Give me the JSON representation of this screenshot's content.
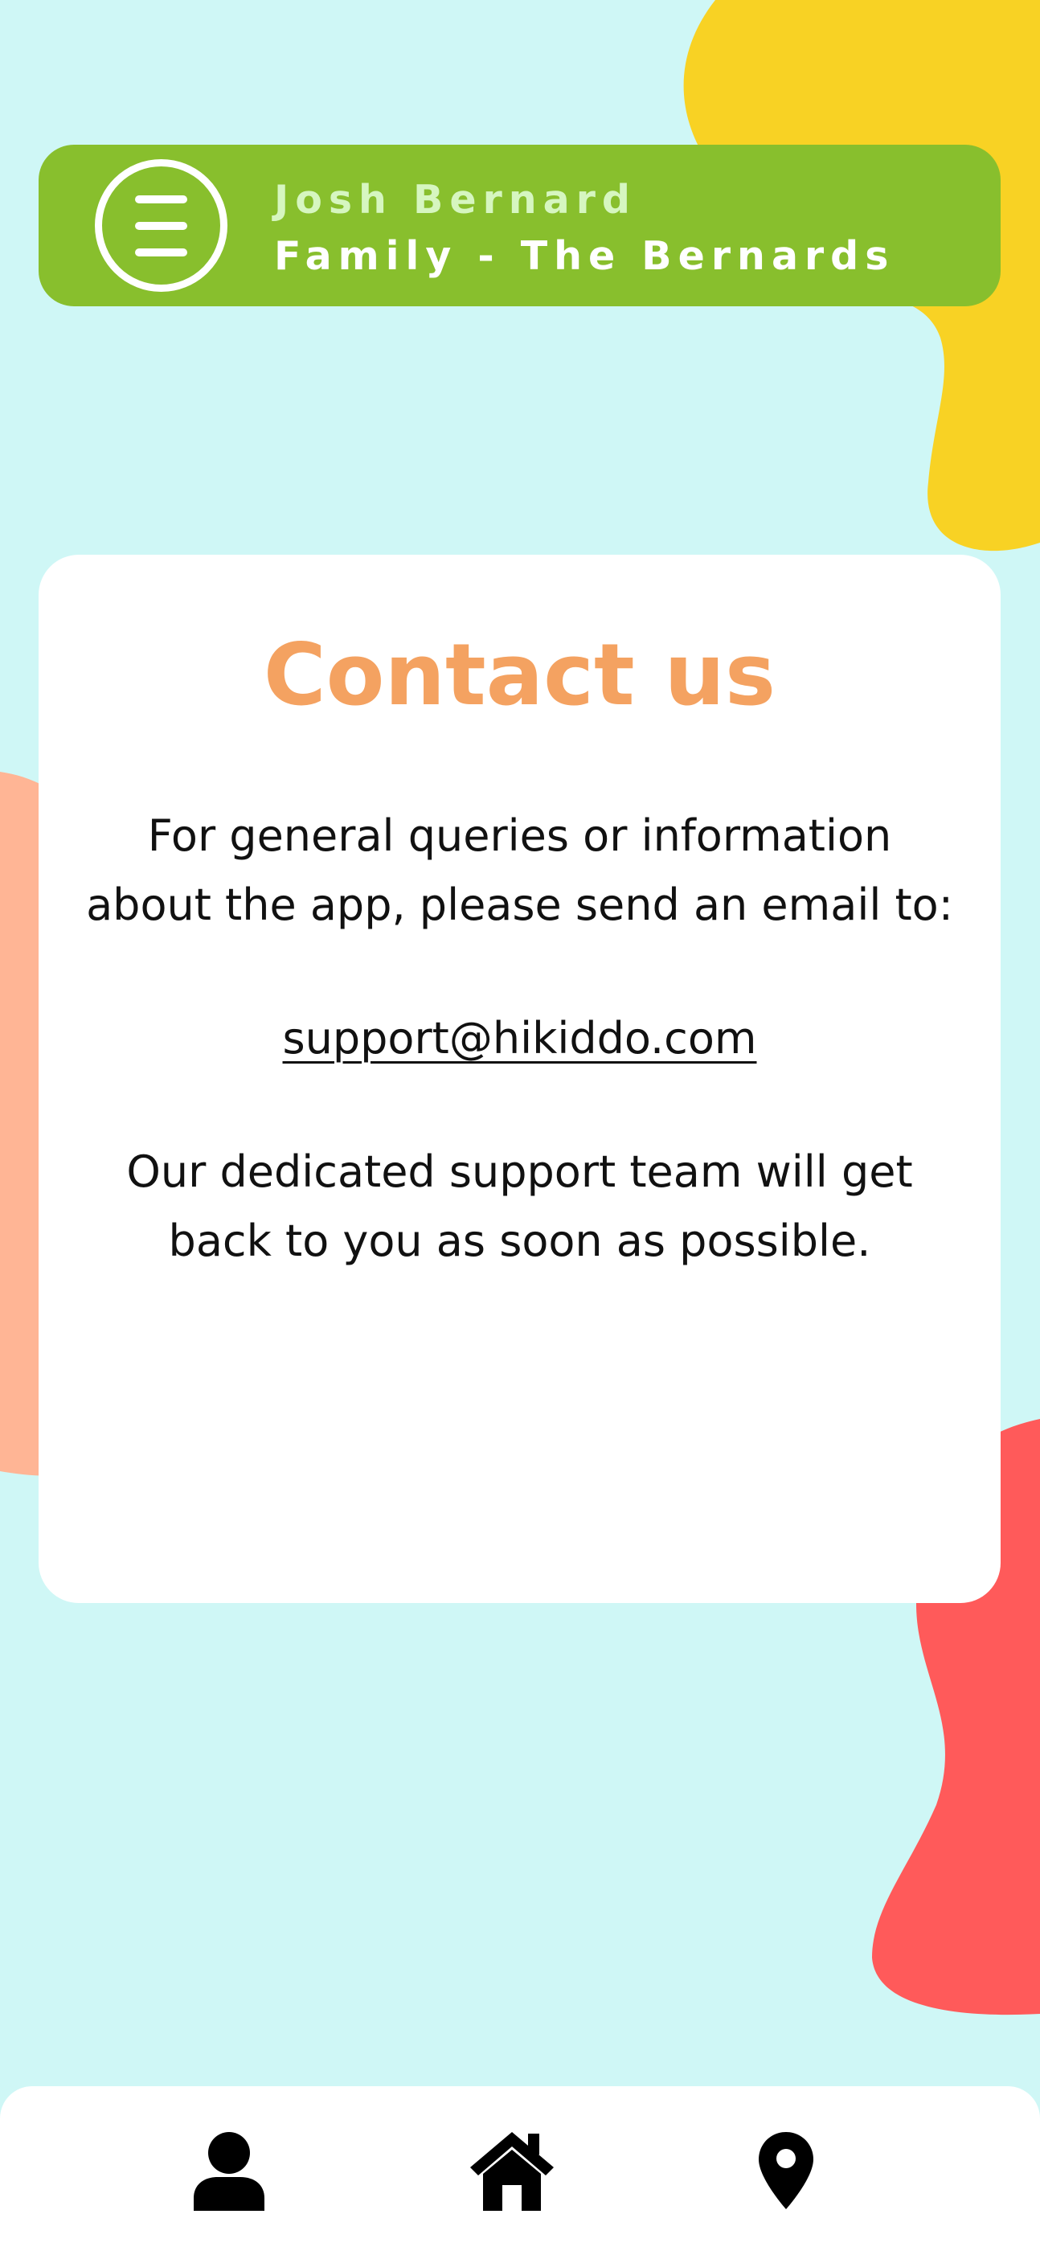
{
  "header": {
    "menu_icon": "hamburger-menu-icon",
    "user_name": "Josh Bernard",
    "family_label": "Family - The Bernards"
  },
  "contact": {
    "title": "Contact us",
    "intro_line_1": "For general queries or information",
    "intro_line_2": "about the app, please send an email to:",
    "email": "support@hikiddo.com",
    "outro_line_1": "Our dedicated support team will get",
    "outro_line_2": "back to you as soon as possible."
  },
  "bottom_nav": {
    "items": [
      {
        "icon": "person-icon"
      },
      {
        "icon": "home-icon"
      },
      {
        "icon": "location-pin-icon"
      }
    ]
  },
  "colors": {
    "background": "#cff7f6",
    "header_bar": "#88bf2d",
    "title_accent": "#f4a261",
    "blob_yellow": "#f8d224",
    "blob_peach": "#ffb595",
    "blob_red": "#ff5a5a"
  }
}
